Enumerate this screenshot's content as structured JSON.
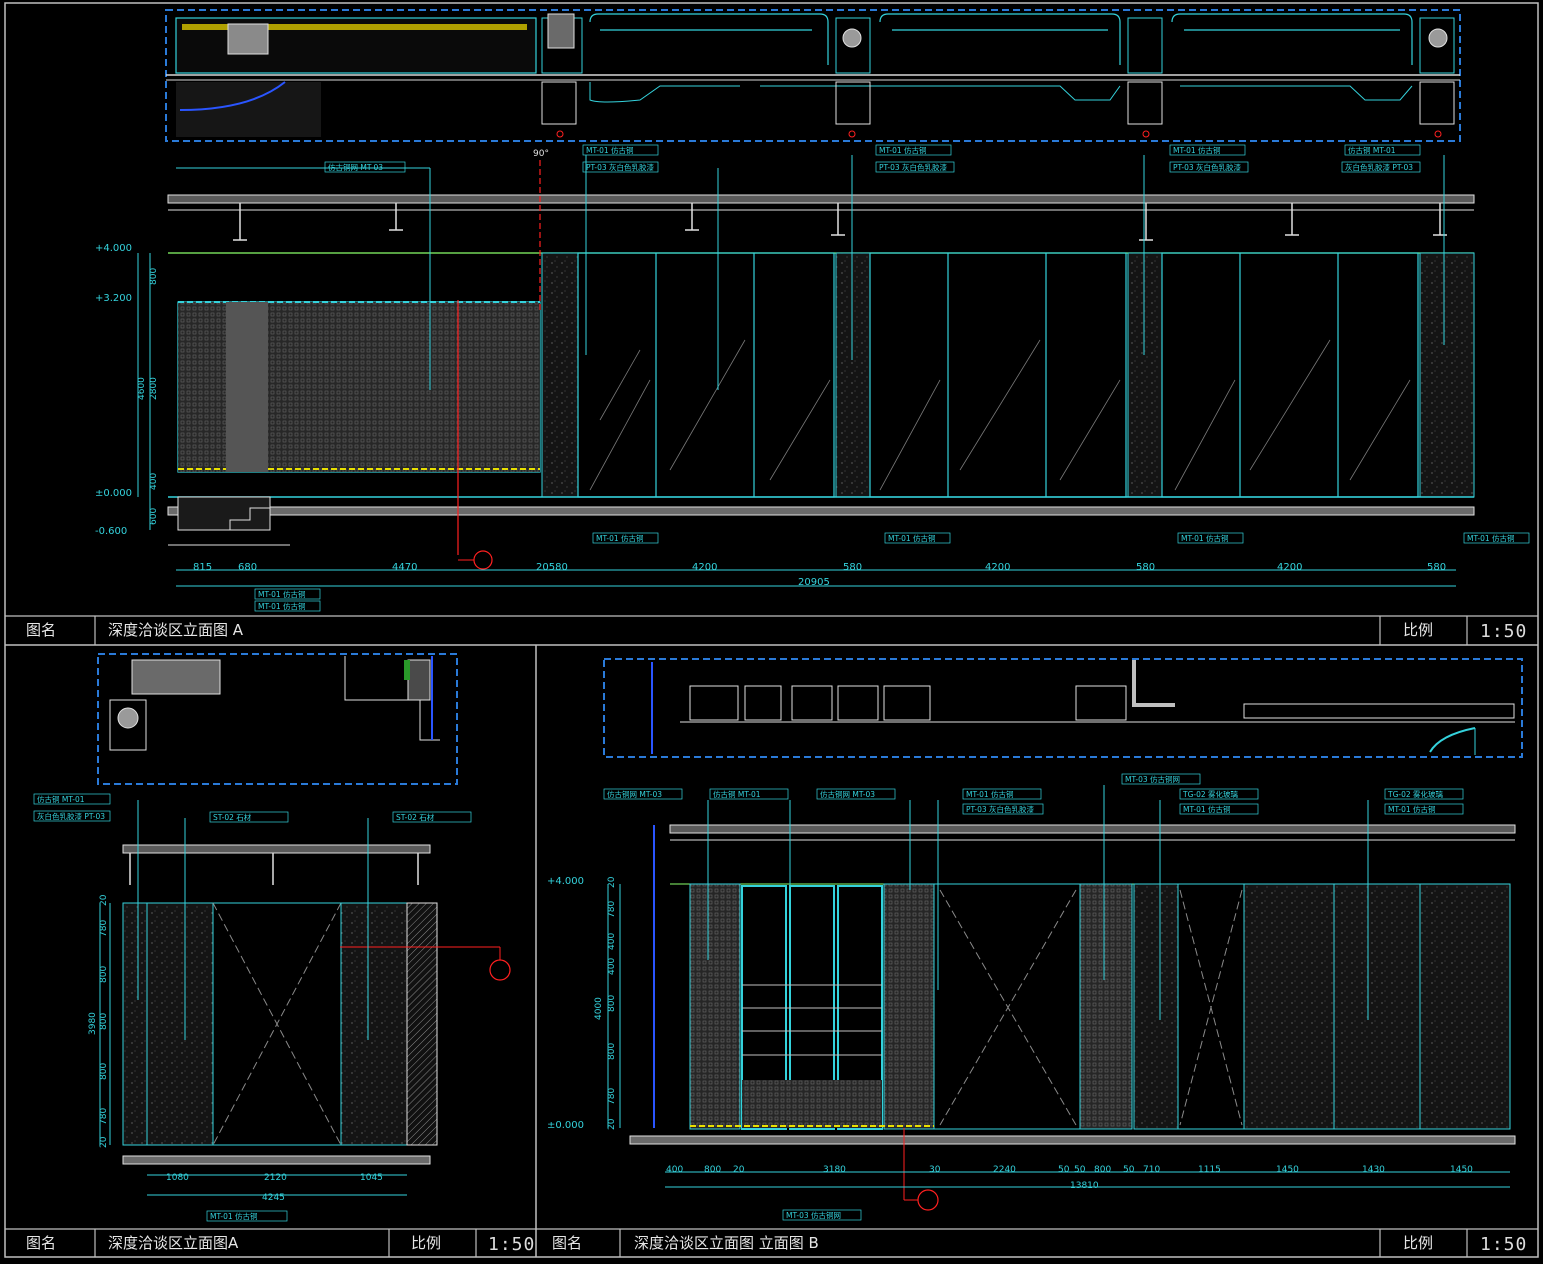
{
  "colors": {
    "background": "#000000",
    "frame": "#bfbfbf",
    "cyan": "#34d2dc",
    "white": "#e6e6e6",
    "red": "#ff2020",
    "blue": "#2a55ff",
    "green": "#7cff5a",
    "yellow": "#e8e000"
  },
  "panel_a": {
    "title_label": "图名",
    "title": "深度洽谈区立面图 A",
    "scale_label": "比例",
    "scale": "1:50",
    "levels": [
      "+4.000",
      "+3.200",
      "±0.000",
      "-0.600"
    ],
    "vertical_dims": [
      "800",
      "2800",
      "4600",
      "400",
      "600"
    ],
    "dims": [
      "815",
      "680",
      "4470",
      "20580",
      "4200",
      "580",
      "4200",
      "580",
      "4200",
      "580"
    ],
    "total_dim": "20905",
    "top_tags": [
      "仿古铜网 MT-03",
      "MT-01 仿古铜",
      "PT-03 灰白色乳胶漆",
      "MT-01 仿古铜",
      "PT-03 灰白色乳胶漆",
      "MT-01 仿古铜",
      "PT-03 灰白色乳胶漆",
      "仿古铜 MT-01",
      "灰白色乳胶漆 PT-03"
    ],
    "bottom_tags": [
      "MT-01 仿古铜",
      "MT-01 仿古铜",
      "MT-01 仿古铜",
      "MT-01 仿古铜",
      "MT-01 仿古铜",
      "MT-01 仿古铜"
    ],
    "angle": "90°"
  },
  "panel_b": {
    "title_label": "图名",
    "title": "深度洽谈区立面图A",
    "scale_label": "比例",
    "scale": "1:50",
    "tags": [
      "仿古铜 MT-01",
      "灰白色乳胶漆 PT-03",
      "ST-02 石材",
      "ST-02 石材"
    ],
    "bottom_tag": "MT-01 仿古铜",
    "vertical_dims": [
      "20",
      "780",
      "800",
      "800",
      "800",
      "780",
      "20",
      "3980"
    ],
    "dims": [
      "1080",
      "2120",
      "1045"
    ],
    "total_dim": "4245"
  },
  "panel_c": {
    "title_label": "图名",
    "title": "深度洽谈区立面图 立面图 B",
    "scale_label": "比例",
    "scale": "1:50",
    "levels": [
      "+4.000",
      "±0.000"
    ],
    "tags": [
      "仿古铜网 MT-03",
      "仿古铜 MT-01",
      "仿古铜网 MT-03",
      "MT-01 仿古铜",
      "PT-03 灰白色乳胶漆",
      "MT-03 仿古铜网",
      "TG-02 雾化玻璃",
      "MT-01 仿古铜",
      "TG-02 雾化玻璃",
      "MT-01 仿古铜"
    ],
    "bottom_tag": "MT-03 仿古铜网",
    "vertical_dims": [
      "20",
      "780",
      "400",
      "400",
      "800",
      "800",
      "780",
      "20",
      "4000"
    ],
    "dims": [
      "400",
      "800",
      "20",
      "3180",
      "30",
      "2240",
      "50",
      "50",
      "800",
      "50",
      "710",
      "1115",
      "1450",
      "1430",
      "1450"
    ],
    "total_dim": "13810"
  }
}
